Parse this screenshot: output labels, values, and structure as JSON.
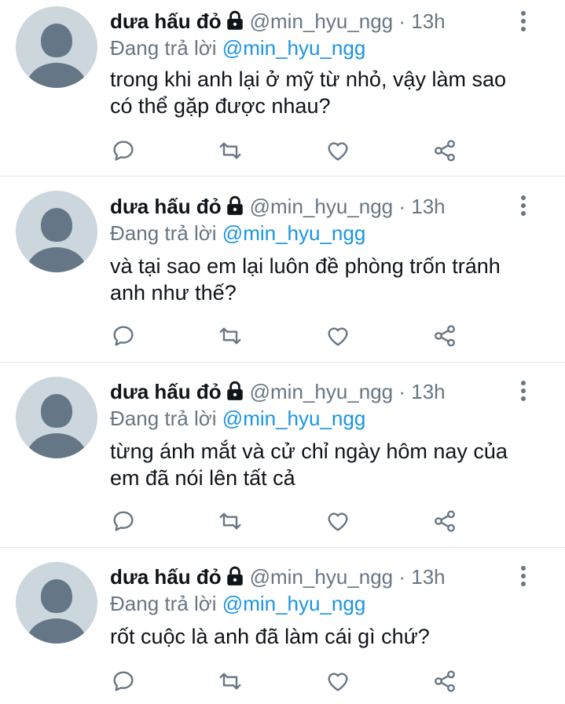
{
  "tweets": [
    {
      "name": "dưa hấu đỏ",
      "handle": "@min_hyu_ngg",
      "dot": "·",
      "time": "13h",
      "reply_prefix": "Đang trả lời",
      "reply_handle": "@min_hyu_ngg",
      "text": "trong khi anh lại ở mỹ từ nhỏ, vậy làm sao có thể gặp được nhau?"
    },
    {
      "name": "dưa hấu đỏ",
      "handle": "@min_hyu_ngg",
      "dot": "·",
      "time": "13h",
      "reply_prefix": "Đang trả lời",
      "reply_handle": "@min_hyu_ngg",
      "text": "và tại sao em lại luôn đề phòng trốn tránh anh như thế?"
    },
    {
      "name": "dưa hấu đỏ",
      "handle": "@min_hyu_ngg",
      "dot": "·",
      "time": "13h",
      "reply_prefix": "Đang trả lời",
      "reply_handle": "@min_hyu_ngg",
      "text": "từng ánh mắt và cử chỉ ngày hôm nay của em đã nói lên tất cả"
    },
    {
      "name": "dưa hấu đỏ",
      "handle": "@min_hyu_ngg",
      "dot": "·",
      "time": "13h",
      "reply_prefix": "Đang trả lời",
      "reply_handle": "@min_hyu_ngg",
      "text": "rốt cuộc là anh đã làm cái gì chứ?"
    }
  ],
  "icons": {
    "avatar": "default-avatar-icon",
    "lock": "lock-icon",
    "more": "more-vertical-icon",
    "reply": "reply-icon",
    "retweet": "retweet-icon",
    "like": "heart-icon",
    "share": "share-icon"
  },
  "colors": {
    "icon": "#687684",
    "link": "#1b95e0",
    "divider": "#dfe3e6",
    "avatar_bg": "#ccd6dd",
    "avatar_fg": "#657786"
  }
}
